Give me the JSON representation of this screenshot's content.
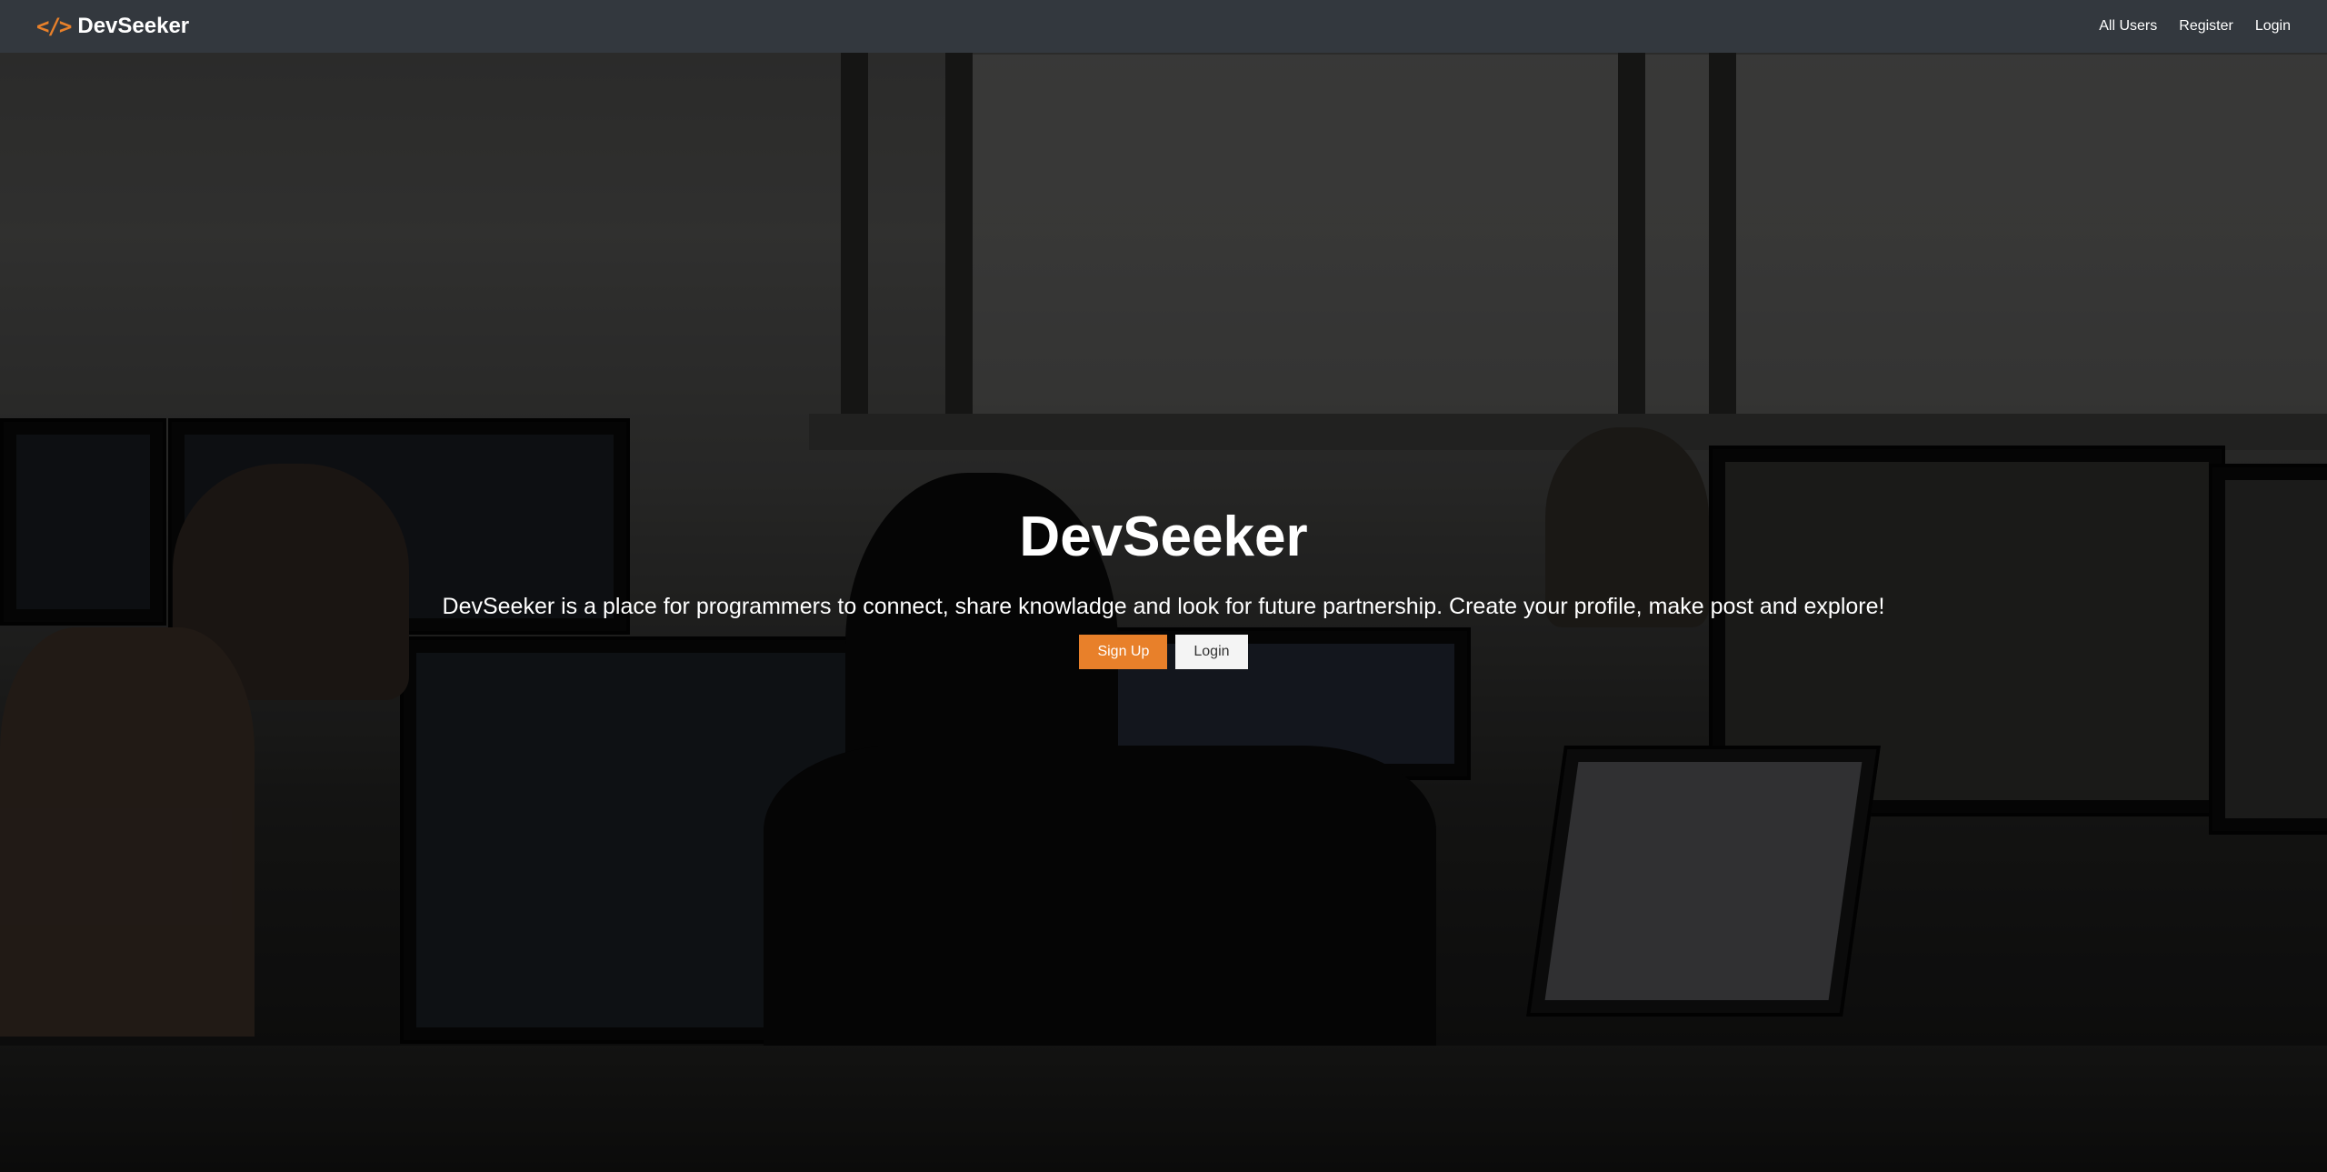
{
  "navbar": {
    "brand_icon": "</>",
    "brand_name": "DevSeeker",
    "links": [
      {
        "label": "All Users"
      },
      {
        "label": "Register"
      },
      {
        "label": "Login"
      }
    ]
  },
  "hero": {
    "title": "DevSeeker",
    "lead": "DevSeeker is a place for programmers to connect, share knowladge and look for future partnership. Create your profile, make post and explore!",
    "signup_label": "Sign Up",
    "login_label": "Login"
  },
  "theme": {
    "accent": "#e8802a",
    "navbar_bg": "#343a40"
  },
  "icons": {
    "brand": "code-icon"
  }
}
